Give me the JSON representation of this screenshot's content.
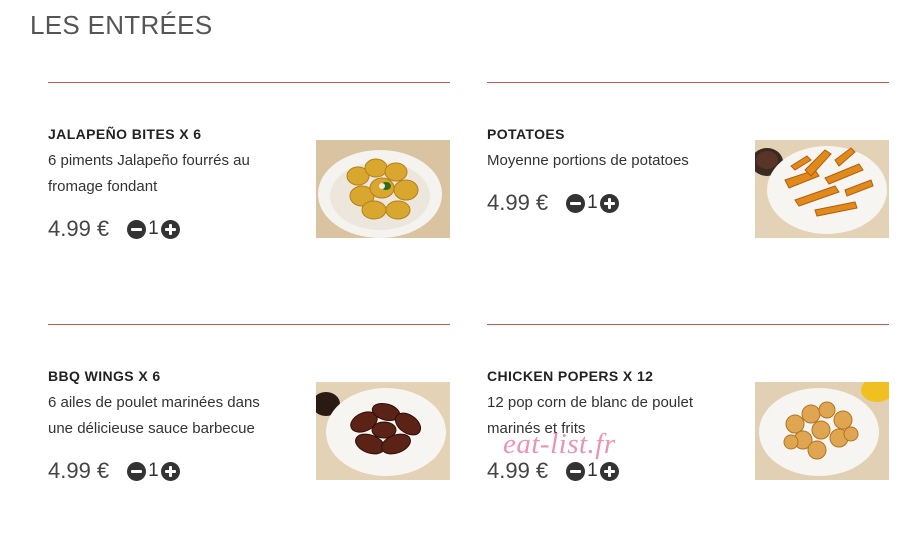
{
  "section": {
    "title": "LES ENTRÉES"
  },
  "products": [
    {
      "name": "JALAPEÑO BITES X 6",
      "description": "6 piments Jalapeño fourrés au fromage fondant",
      "price": "4.99 €",
      "quantity": "1",
      "image": "jalapeno-bites-photo"
    },
    {
      "name": "POTATOES",
      "description": "Moyenne portions de potatoes",
      "price": "4.99 €",
      "quantity": "1",
      "image": "potatoes-photo"
    },
    {
      "name": "BBQ WINGS X 6",
      "description": "6 ailes de poulet marinées dans une délicieuse sauce barbecue",
      "price": "4.99 €",
      "quantity": "1",
      "image": "bbq-wings-photo"
    },
    {
      "name": "CHICKEN POPERS X 12",
      "description": "12 pop corn de blanc de poulet marinés et frits",
      "price": "4.99 €",
      "quantity": "1",
      "image": "chicken-popers-photo"
    }
  ],
  "watermark": "eat-list.fr",
  "colors": {
    "divider": "#c0392b",
    "text": "#333333",
    "button": "#333333",
    "watermark": "#ea7fa8"
  }
}
